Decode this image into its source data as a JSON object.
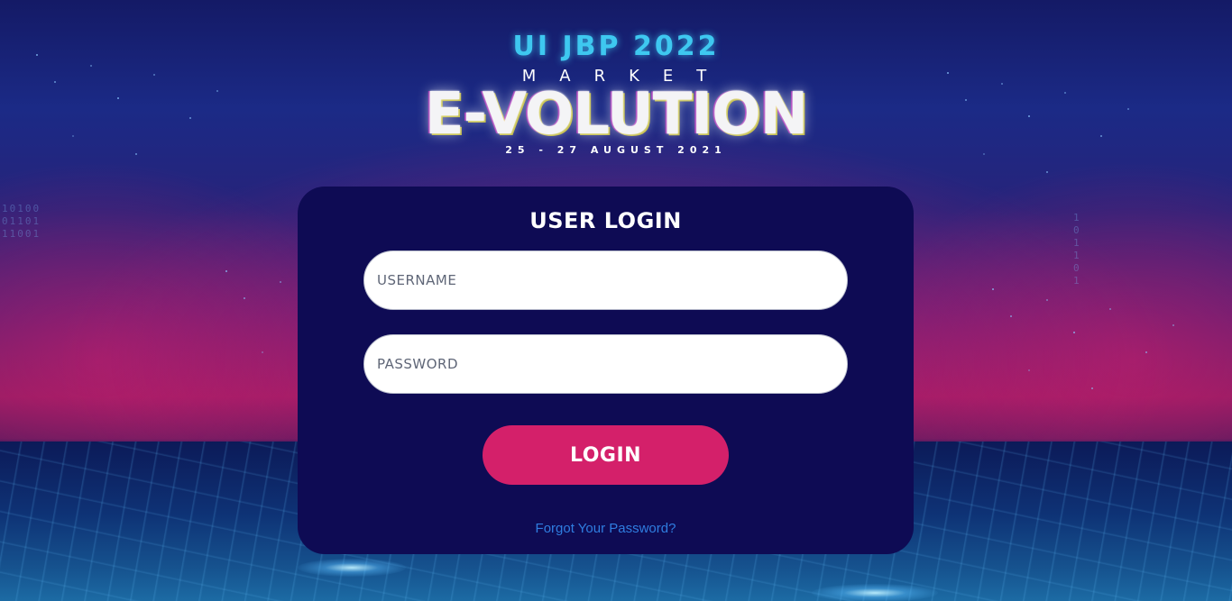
{
  "logo": {
    "line1": "UI JBP 2022",
    "line2": "MARKET",
    "line3": "E-VOLUTION",
    "line4": "25 - 27 AUGUST 2021"
  },
  "login": {
    "title": "USER LOGIN",
    "username_placeholder": "USERNAME",
    "password_placeholder": "PASSWORD",
    "button_label": "LOGIN",
    "forgot_link": "Forgot Your Password?"
  },
  "colors": {
    "card_background": "#0e0b54",
    "button_background": "#d4206a",
    "link": "#2f7de0",
    "logo_accent": "#3ec8f0"
  }
}
